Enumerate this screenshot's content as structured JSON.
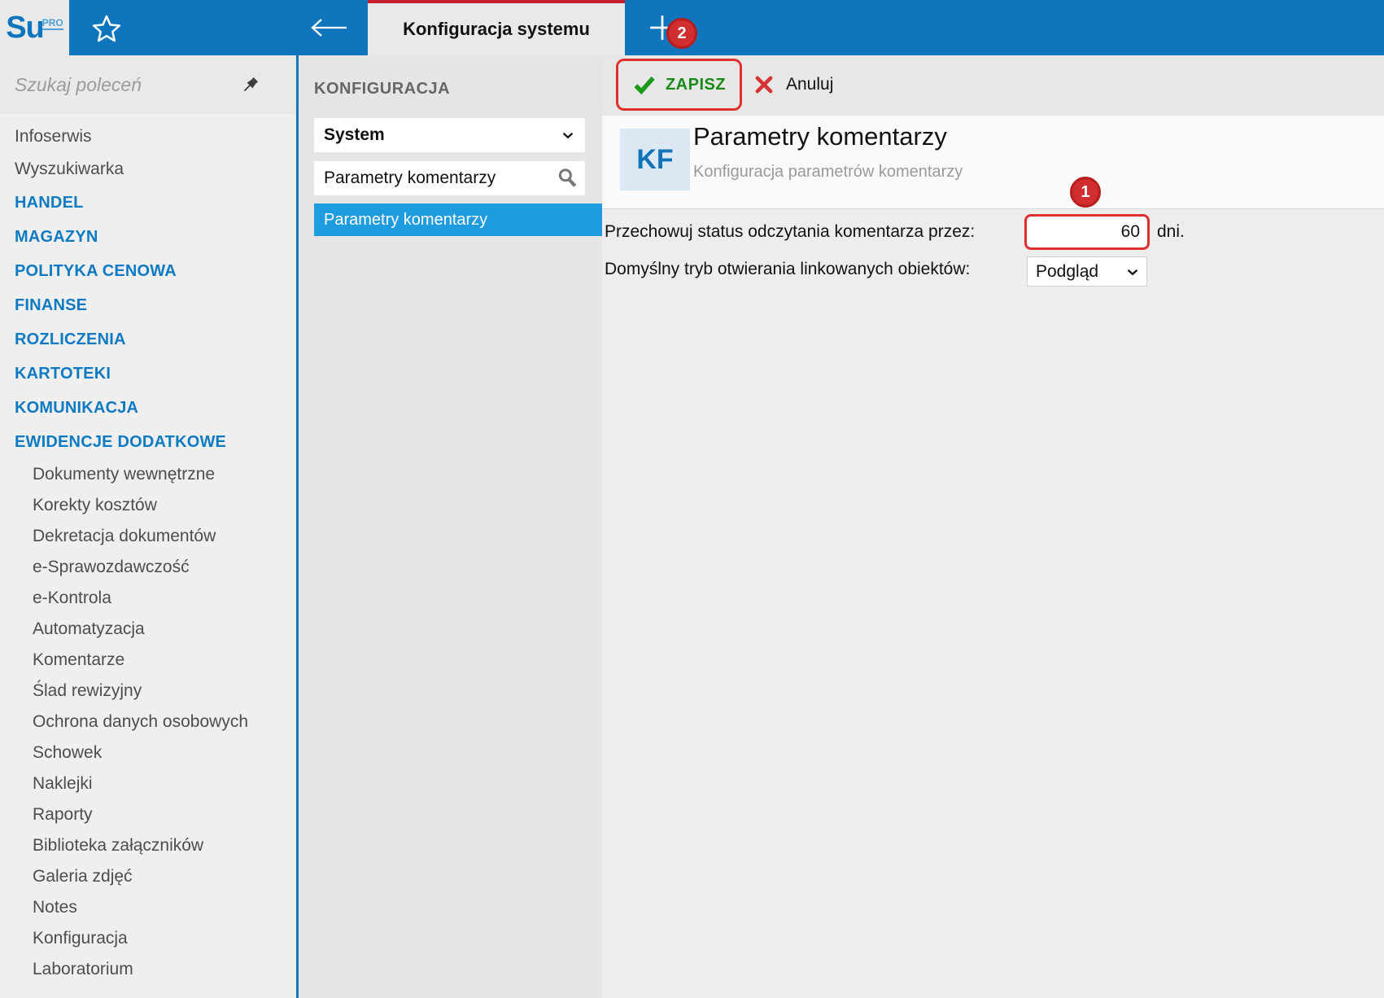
{
  "app": {
    "logo_text": "Su",
    "logo_sup": "PRO"
  },
  "topbar": {
    "tab_title": "Konfiguracja systemu",
    "new_tab_badge": "2"
  },
  "sidebar": {
    "search_placeholder": "Szukaj poleceń",
    "items": [
      {
        "label": "Infoserwis",
        "type": "item"
      },
      {
        "label": "Wyszukiwarka",
        "type": "item"
      },
      {
        "label": "HANDEL",
        "type": "category"
      },
      {
        "label": "MAGAZYN",
        "type": "category"
      },
      {
        "label": "POLITYKA CENOWA",
        "type": "category"
      },
      {
        "label": "FINANSE",
        "type": "category"
      },
      {
        "label": "ROZLICZENIA",
        "type": "category"
      },
      {
        "label": "KARTOTEKI",
        "type": "category"
      },
      {
        "label": "KOMUNIKACJA",
        "type": "category"
      },
      {
        "label": "EWIDENCJE DODATKOWE",
        "type": "category"
      },
      {
        "label": "Dokumenty wewnętrzne",
        "type": "subitem"
      },
      {
        "label": "Korekty kosztów",
        "type": "subitem"
      },
      {
        "label": "Dekretacja dokumentów",
        "type": "subitem"
      },
      {
        "label": "e-Sprawozdawczość",
        "type": "subitem"
      },
      {
        "label": "e-Kontrola",
        "type": "subitem"
      },
      {
        "label": "Automatyzacja",
        "type": "subitem"
      },
      {
        "label": "Komentarze",
        "type": "subitem"
      },
      {
        "label": "Ślad rewizyjny",
        "type": "subitem"
      },
      {
        "label": "Ochrona danych osobowych",
        "type": "subitem"
      },
      {
        "label": "Schowek",
        "type": "subitem"
      },
      {
        "label": "Naklejki",
        "type": "subitem"
      },
      {
        "label": "Raporty",
        "type": "subitem"
      },
      {
        "label": "Biblioteka załączników",
        "type": "subitem"
      },
      {
        "label": "Galeria zdjęć",
        "type": "subitem"
      },
      {
        "label": "Notes",
        "type": "subitem"
      },
      {
        "label": "Konfiguracja",
        "type": "subitem"
      },
      {
        "label": "Laboratorium",
        "type": "subitem"
      }
    ]
  },
  "config_panel": {
    "title": "KONFIGURACJA",
    "section_select_value": "System",
    "search_value": "Parametry komentarzy",
    "selected_item": "Parametry komentarzy"
  },
  "toolbar": {
    "save_label": "ZAPISZ",
    "cancel_label": "Anuluj"
  },
  "content": {
    "initials": "KF",
    "title": "Parametry komentarzy",
    "subtitle": "Konfiguracja parametrów komentarzy",
    "annotation_badge": "1",
    "fields": [
      {
        "label": "Przechowuj status odczytania komentarza przez:",
        "value": "60",
        "suffix": "dni.",
        "type": "input"
      },
      {
        "label": "Domyślny tryb otwierania linkowanych obiektów:",
        "value": "Podgląd",
        "type": "select"
      }
    ]
  },
  "colors": {
    "topbar_blue": "#0f76bd",
    "selection_blue": "#1f9cdf",
    "category_blue": "#0e7ac1",
    "tab_accent_red": "#c51f30",
    "annotation_red": "#df3030",
    "badge_red": "#d12f2f",
    "save_green": "#178a17",
    "cancel_red": "#d63434",
    "kf_badge_bg": "#dce9f5"
  }
}
